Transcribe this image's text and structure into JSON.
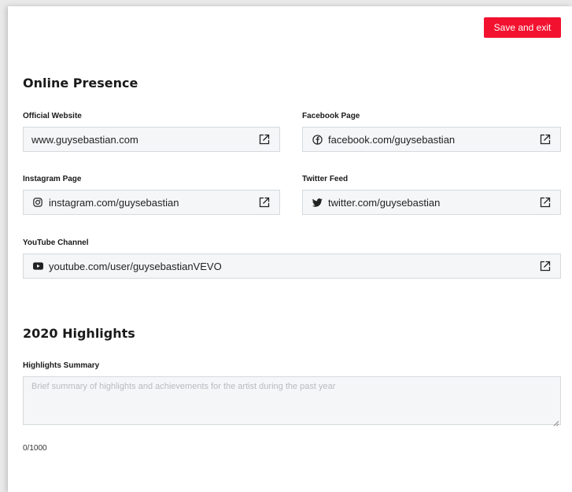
{
  "header": {
    "save_label": "Save and exit"
  },
  "online_presence": {
    "title": "Online Presence",
    "website": {
      "label": "Official Website",
      "value": "www.guysebastian.com"
    },
    "facebook": {
      "label": "Facebook Page",
      "value": "facebook.com/guysebastian",
      "icon": "facebook-icon"
    },
    "instagram": {
      "label": "Instagram Page",
      "value": "instagram.com/guysebastian",
      "icon": "instagram-icon"
    },
    "twitter": {
      "label": "Twitter Feed",
      "value": "twitter.com/guysebastian",
      "icon": "twitter-icon"
    },
    "youtube": {
      "label": "YouTube Channel",
      "value": "youtube.com/user/guysebastianVEVO",
      "icon": "youtube-icon"
    }
  },
  "highlights": {
    "title": "2020 Highlights",
    "summary_label": "Highlights Summary",
    "summary_placeholder": "Brief summary of highlights and achievements for the artist during the past year",
    "summary_value": "",
    "counter": "0/1000"
  },
  "colors": {
    "accent": "#f2112f",
    "field_bg": "#f4f6f7",
    "field_border": "#d6dadd"
  }
}
